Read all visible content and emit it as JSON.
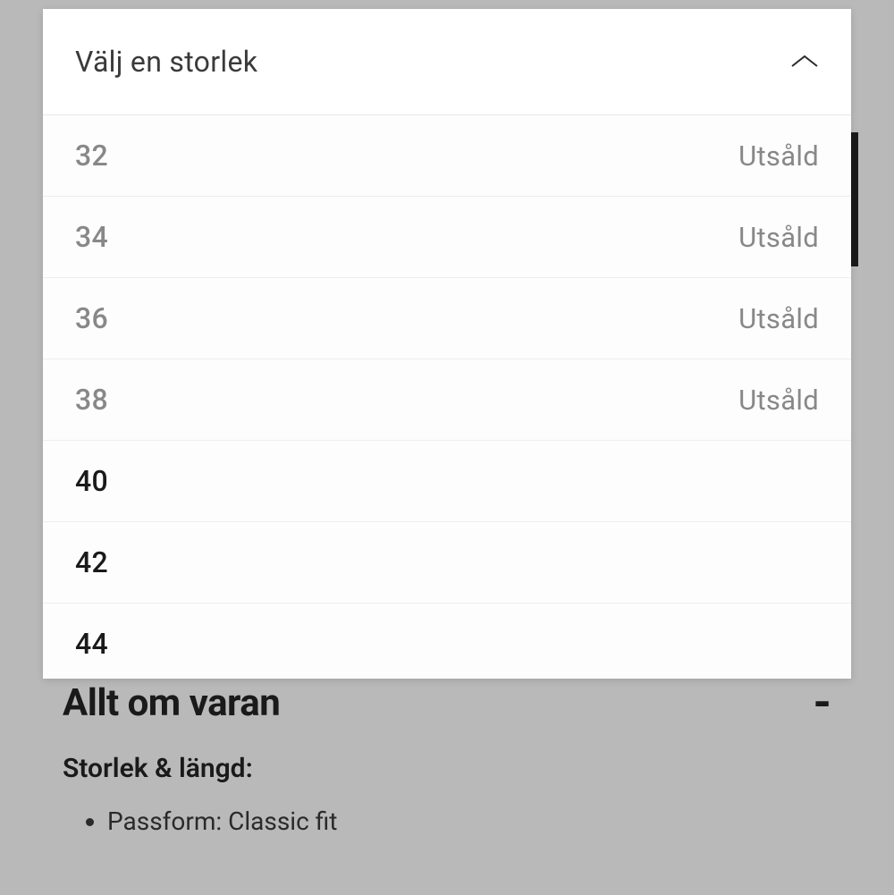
{
  "dropdown": {
    "label": "Välj en storlek",
    "sizes": [
      {
        "value": "32",
        "status": "Utsåld",
        "soldOut": true
      },
      {
        "value": "34",
        "status": "Utsåld",
        "soldOut": true
      },
      {
        "value": "36",
        "status": "Utsåld",
        "soldOut": true
      },
      {
        "value": "38",
        "status": "Utsåld",
        "soldOut": true
      },
      {
        "value": "40",
        "status": "",
        "soldOut": false
      },
      {
        "value": "42",
        "status": "",
        "soldOut": false
      },
      {
        "value": "44",
        "status": "",
        "soldOut": false
      }
    ]
  },
  "productInfo": {
    "sectionTitle": "Allt om varan",
    "collapseSymbol": "-",
    "subsectionTitle": "Storlek & längd:",
    "details": [
      "Passform: Classic fit"
    ]
  }
}
